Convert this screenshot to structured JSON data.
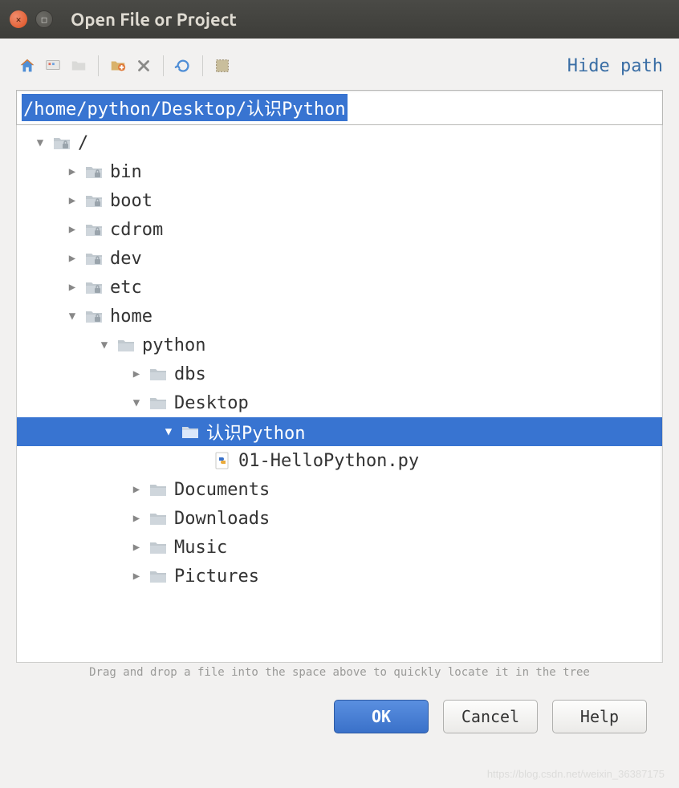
{
  "window": {
    "title": "Open File or Project"
  },
  "toolbar": {
    "hide_path": "Hide path"
  },
  "path_input": {
    "value": "/home/python/Desktop/认识Python"
  },
  "tree": {
    "rows": [
      {
        "indent": 0,
        "arrow": "down",
        "icon": "folder-lock",
        "label": "/",
        "selected": false
      },
      {
        "indent": 1,
        "arrow": "right",
        "icon": "folder-lock",
        "label": "bin",
        "selected": false
      },
      {
        "indent": 1,
        "arrow": "right",
        "icon": "folder-lock",
        "label": "boot",
        "selected": false
      },
      {
        "indent": 1,
        "arrow": "right",
        "icon": "folder-lock",
        "label": "cdrom",
        "selected": false
      },
      {
        "indent": 1,
        "arrow": "right",
        "icon": "folder-lock",
        "label": "dev",
        "selected": false
      },
      {
        "indent": 1,
        "arrow": "right",
        "icon": "folder-lock",
        "label": "etc",
        "selected": false
      },
      {
        "indent": 1,
        "arrow": "down",
        "icon": "folder-lock",
        "label": "home",
        "selected": false
      },
      {
        "indent": 2,
        "arrow": "down",
        "icon": "folder",
        "label": "python",
        "selected": false
      },
      {
        "indent": 3,
        "arrow": "right",
        "icon": "folder",
        "label": "dbs",
        "selected": false
      },
      {
        "indent": 3,
        "arrow": "down",
        "icon": "folder",
        "label": "Desktop",
        "selected": false
      },
      {
        "indent": 4,
        "arrow": "down",
        "icon": "folder",
        "label": "认识Python",
        "selected": true
      },
      {
        "indent": 5,
        "arrow": "none",
        "icon": "pyfile",
        "label": "01-HelloPython.py",
        "selected": false
      },
      {
        "indent": 3,
        "arrow": "right",
        "icon": "folder",
        "label": "Documents",
        "selected": false
      },
      {
        "indent": 3,
        "arrow": "right",
        "icon": "folder",
        "label": "Downloads",
        "selected": false
      },
      {
        "indent": 3,
        "arrow": "right",
        "icon": "folder",
        "label": "Music",
        "selected": false
      },
      {
        "indent": 3,
        "arrow": "right",
        "icon": "folder",
        "label": "Pictures",
        "selected": false
      }
    ]
  },
  "hint": "Drag and drop a file into the space above to quickly locate it in the tree",
  "buttons": {
    "ok": "OK",
    "cancel": "Cancel",
    "help": "Help"
  },
  "watermark": "https://blog.csdn.net/weixin_36387175"
}
